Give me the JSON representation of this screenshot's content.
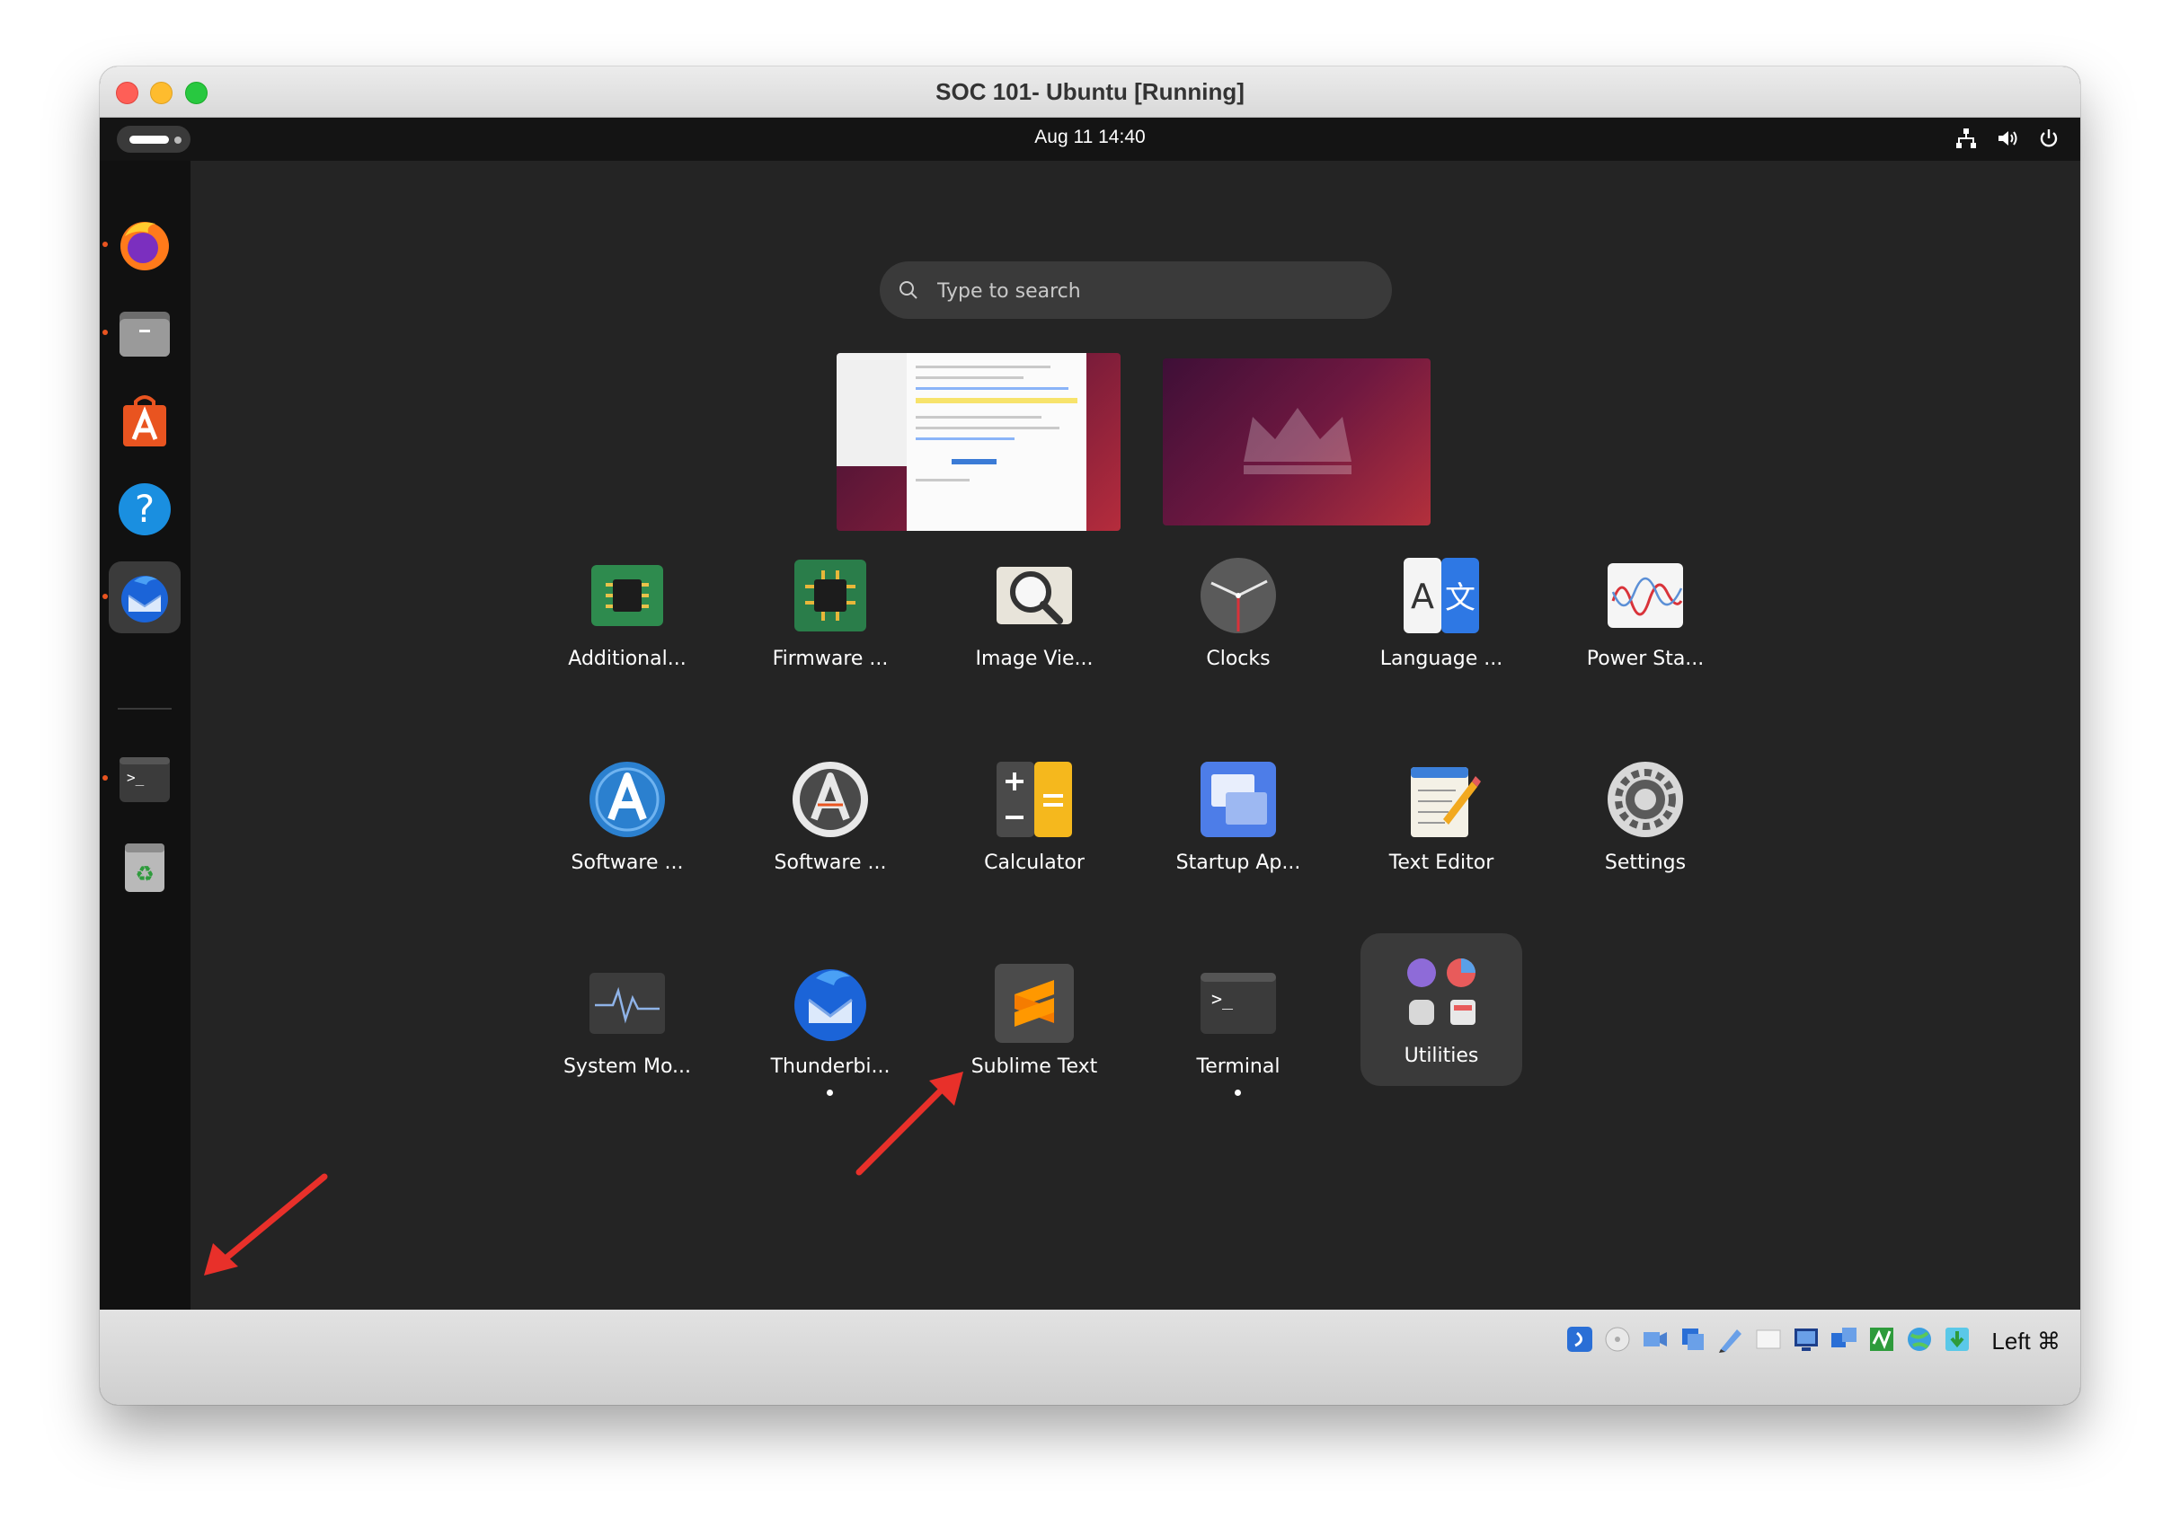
{
  "window": {
    "title": "SOC 101- Ubuntu [Running]"
  },
  "topbar": {
    "clock": "Aug 11  14:40"
  },
  "search": {
    "placeholder": "Type to search"
  },
  "apps": [
    {
      "label": "Additional..."
    },
    {
      "label": "Firmware ..."
    },
    {
      "label": "Image Vie..."
    },
    {
      "label": "Clocks"
    },
    {
      "label": "Language ..."
    },
    {
      "label": "Power Sta..."
    },
    {
      "label": "Software ..."
    },
    {
      "label": "Software ..."
    },
    {
      "label": "Calculator"
    },
    {
      "label": "Startup Ap..."
    },
    {
      "label": "Text Editor"
    },
    {
      "label": "Settings"
    },
    {
      "label": "System Mo..."
    },
    {
      "label": "Thunderbi..."
    },
    {
      "label": "Sublime Text"
    },
    {
      "label": "Terminal"
    },
    {
      "label": "Utilities"
    }
  ],
  "statusbar": {
    "host_key": "Left ⌘"
  },
  "colors": {
    "accent": "#e95420",
    "annotation_arrow": "#e8302a"
  }
}
